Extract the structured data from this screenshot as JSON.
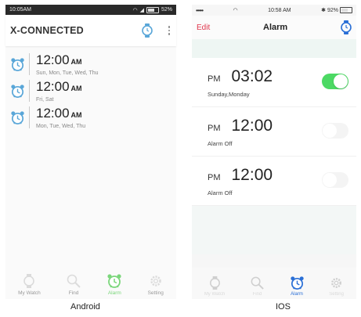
{
  "colors": {
    "android_accent": "#59a6d8",
    "android_active_tab": "#7bd67b",
    "ios_accent": "#2a6fd6",
    "ios_edit": "#e0344a",
    "ios_toggle_on": "#4cd964"
  },
  "android": {
    "status": {
      "time": "10:05AM",
      "battery": "52%"
    },
    "title": "X-CONNECTED",
    "alarms": [
      {
        "time": "12:00",
        "ampm": "AM",
        "days": "Sun, Mon, Tue, Wed, Thu",
        "icon": "alarm-clock-icon"
      },
      {
        "time": "12:00",
        "ampm": "AM",
        "days": "Fri, Sat",
        "icon": "alarm-clock-icon"
      },
      {
        "time": "12:00",
        "ampm": "AM",
        "days": "Mon, Tue, Wed, Thu",
        "icon": "alarm-clock-icon"
      }
    ],
    "tabs": [
      {
        "label": "My Watch",
        "icon": "watch-icon"
      },
      {
        "label": "Find",
        "icon": "search-icon"
      },
      {
        "label": "Alarm",
        "icon": "alarm-clock-icon"
      },
      {
        "label": "Setting",
        "icon": "gear-icon"
      }
    ],
    "caption": "Android"
  },
  "ios": {
    "status": {
      "signal": "•••••",
      "time": "10:58 AM",
      "battery": "92%"
    },
    "edit_label": "Edit",
    "title": "Alarm",
    "alarms": [
      {
        "ampm": "PM",
        "time": "03:02",
        "subtitle": "Sunday,Monday",
        "enabled": true
      },
      {
        "ampm": "PM",
        "time": "12:00",
        "subtitle": "Alarm Off",
        "enabled": false
      },
      {
        "ampm": "PM",
        "time": "12:00",
        "subtitle": "Alarm Off",
        "enabled": false
      }
    ],
    "tabs": [
      {
        "label": "My Watch",
        "icon": "watch-icon"
      },
      {
        "label": "Find",
        "icon": "search-icon"
      },
      {
        "label": "Alarm",
        "icon": "alarm-clock-icon"
      },
      {
        "label": "Setting",
        "icon": "gear-icon"
      }
    ],
    "caption": "IOS"
  }
}
